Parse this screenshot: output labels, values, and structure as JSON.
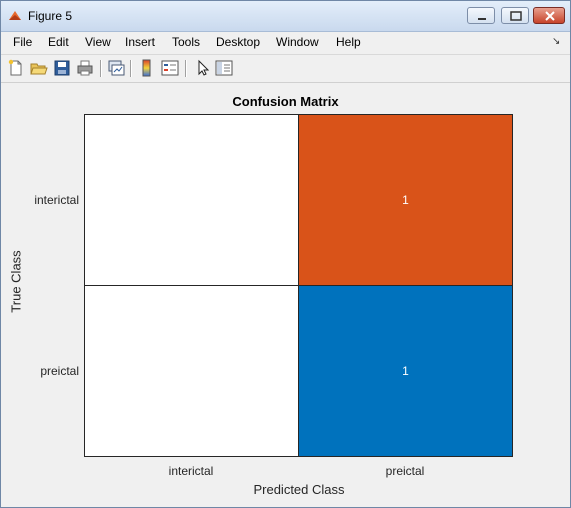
{
  "window": {
    "title": "Figure 5"
  },
  "menu": [
    "File",
    "Edit",
    "View",
    "Insert",
    "Tools",
    "Desktop",
    "Window",
    "Help"
  ],
  "toolbar_icons": [
    "new-figure-icon",
    "open-file-icon",
    "save-icon",
    "print-icon",
    "link-plot-icon",
    "insert-colorbar-icon",
    "insert-legend-icon",
    "edit-plot-arrow-icon",
    "show-plot-tools-icon"
  ],
  "chart_data": {
    "type": "heatmap",
    "title": "Confusion Matrix",
    "xlabel": "Predicted Class",
    "ylabel": "True Class",
    "x_categories": [
      "interictal",
      "preictal"
    ],
    "y_categories": [
      "interictal",
      "preictal"
    ],
    "values": [
      [
        0,
        1
      ],
      [
        0,
        1
      ]
    ],
    "cell_labels": [
      [
        "",
        "1"
      ],
      [
        "",
        "1"
      ]
    ],
    "cell_colors": [
      [
        "#ffffff",
        "#d95319"
      ],
      [
        "#ffffff",
        "#0072bd"
      ]
    ]
  }
}
